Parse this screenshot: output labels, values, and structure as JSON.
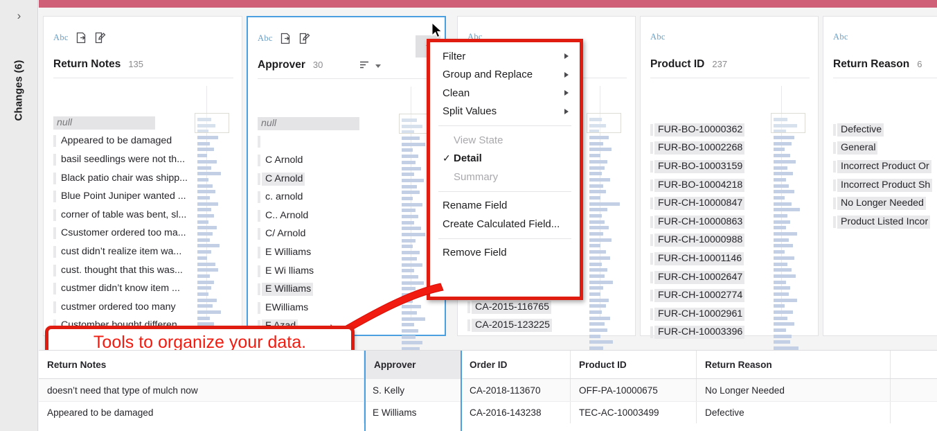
{
  "theme": {
    "accent_bar": "#cf5f76",
    "selection_blue": "#4a9fe0",
    "callout_red": "#e01b10",
    "highlight_gray": "#e9e9eb",
    "hist_bar": "#c2cfe4"
  },
  "sidebar": {
    "label": "Changes (6)",
    "expand_icon": "chevron-right-icon"
  },
  "callout": {
    "text": "Tools to organize your data."
  },
  "context_menu": {
    "items": [
      {
        "label": "Filter",
        "submenu": true,
        "disabled": false,
        "checked": false
      },
      {
        "label": "Group and Replace",
        "submenu": true,
        "disabled": false,
        "checked": false
      },
      {
        "label": "Clean",
        "submenu": true,
        "disabled": false,
        "checked": false
      },
      {
        "label": "Split Values",
        "submenu": true,
        "disabled": false,
        "checked": false
      },
      {
        "label": "View State",
        "submenu": false,
        "disabled": true,
        "checked": false
      },
      {
        "label": "Detail",
        "submenu": false,
        "disabled": false,
        "checked": true
      },
      {
        "label": "Summary",
        "submenu": false,
        "disabled": true,
        "checked": false
      },
      {
        "label": "Rename Field",
        "submenu": false,
        "disabled": false,
        "checked": false
      },
      {
        "label": "Create Calculated Field...",
        "submenu": false,
        "disabled": false,
        "checked": false
      },
      {
        "label": "Remove Field",
        "submenu": false,
        "disabled": false,
        "checked": false
      }
    ]
  },
  "profile_cards": [
    {
      "type_label": "Abc",
      "title": "Return Notes",
      "count": "135",
      "selected": false,
      "values": [
        {
          "text": "null",
          "is_null": true
        },
        {
          "text": "Appeared to be damaged",
          "highlight": false
        },
        {
          "text": "basil seedlings were not th...",
          "highlight": false
        },
        {
          "text": "Black patio chair was shipp...",
          "highlight": false
        },
        {
          "text": "Blue Point Juniper wanted ...",
          "highlight": false
        },
        {
          "text": "corner of table was bent, sl...",
          "highlight": false
        },
        {
          "text": "Csustomer ordered too ma...",
          "highlight": false
        },
        {
          "text": "cust didn’t realize item wa...",
          "highlight": false
        },
        {
          "text": "cust. thought that this was...",
          "highlight": false
        },
        {
          "text": "custmer didn’t know item ...",
          "highlight": false
        },
        {
          "text": "custmer ordered too many",
          "highlight": false
        },
        {
          "text": "Customber bought differen..",
          "highlight": false
        }
      ]
    },
    {
      "type_label": "Abc",
      "title": "Approver",
      "count": "30",
      "selected": true,
      "sort_icon": "sort-icon",
      "menu_icon": "chevron-down-icon",
      "values": [
        {
          "text": "null",
          "is_null": true
        },
        {
          "text": "",
          "highlight": false
        },
        {
          "text": "C  Arnold",
          "highlight": false
        },
        {
          "text": "C Arnold",
          "highlight": true
        },
        {
          "text": "c. arnold",
          "highlight": false
        },
        {
          "text": "C.. Arnold",
          "highlight": false
        },
        {
          "text": "C/ Arnold",
          "highlight": false
        },
        {
          "text": "E  Williams",
          "highlight": false
        },
        {
          "text": "E Wi lliams",
          "highlight": false
        },
        {
          "text": "E Williams",
          "highlight": true
        },
        {
          "text": "EWilliams",
          "highlight": false
        },
        {
          "text": "F Azad",
          "highlight": true
        }
      ]
    },
    {
      "type_label": "Abc",
      "title": "",
      "count": "",
      "selected": false,
      "values": [
        {
          "text": "CA-2015-116765",
          "highlight": true
        },
        {
          "text": "CA-2015-123225",
          "highlight": true
        }
      ]
    },
    {
      "type_label": "Abc",
      "title": "Product ID",
      "count": "237",
      "selected": false,
      "values": [
        {
          "text": "FUR-BO-10000362",
          "highlight": true
        },
        {
          "text": "FUR-BO-10002268",
          "highlight": true
        },
        {
          "text": "FUR-BO-10003159",
          "highlight": true
        },
        {
          "text": "FUR-BO-10004218",
          "highlight": true
        },
        {
          "text": "FUR-CH-10000847",
          "highlight": true
        },
        {
          "text": "FUR-CH-10000863",
          "highlight": true
        },
        {
          "text": "FUR-CH-10000988",
          "highlight": true
        },
        {
          "text": "FUR-CH-10001146",
          "highlight": true
        },
        {
          "text": "FUR-CH-10002647",
          "highlight": true
        },
        {
          "text": "FUR-CH-10002774",
          "highlight": true
        },
        {
          "text": "FUR-CH-10002961",
          "highlight": true
        },
        {
          "text": "FUR-CH-10003396",
          "highlight": true
        }
      ]
    },
    {
      "type_label": "Abc",
      "title": "Return Reason",
      "count": "6",
      "selected": false,
      "values": [
        {
          "text": "Defective",
          "highlight": true
        },
        {
          "text": "General",
          "highlight": true
        },
        {
          "text": "Incorrect Product Or",
          "highlight": true
        },
        {
          "text": "Incorrect Product Sh",
          "highlight": true
        },
        {
          "text": "No Longer Needed",
          "highlight": true
        },
        {
          "text": "Product Listed Incor",
          "highlight": true
        }
      ]
    }
  ],
  "data_grid": {
    "columns": [
      "Return Notes",
      "Approver",
      "Order ID",
      "Product ID",
      "Return Reason"
    ],
    "selected_column": "Approver",
    "rows": [
      [
        "doesn’t need that type of mulch now",
        "S. Kelly",
        "CA-2018-113670",
        "OFF-PA-10000675",
        "No Longer Needed"
      ],
      [
        "Appeared to be damaged",
        "E Williams",
        "CA-2016-143238",
        "TEC-AC-10003499",
        "Defective"
      ]
    ]
  }
}
